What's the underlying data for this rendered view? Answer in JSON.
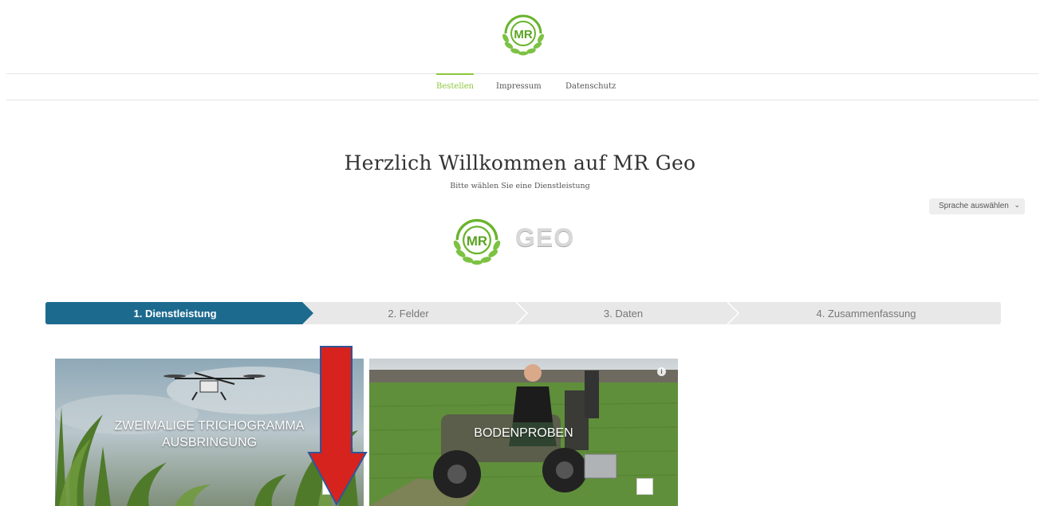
{
  "header": {
    "logo_text": "MR"
  },
  "nav": {
    "items": [
      {
        "label": "Bestellen",
        "active": true
      },
      {
        "label": "Impressum",
        "active": false
      },
      {
        "label": "Datenschutz",
        "active": false
      }
    ]
  },
  "main": {
    "title": "Herzlich Willkommen auf MR Geo",
    "subtitle": "Bitte wählen Sie eine Dienstleistung",
    "geo_logo_mr": "MR",
    "geo_logo_text": "GEO"
  },
  "language_select": {
    "label": "Sprache auswählen"
  },
  "steps": [
    {
      "label": "1. Dienstleistung",
      "active": true
    },
    {
      "label": "2. Felder",
      "active": false
    },
    {
      "label": "3. Daten",
      "active": false
    },
    {
      "label": "4. Zusammenfassung",
      "active": false
    }
  ],
  "services": [
    {
      "title_line1": "ZWEIMALIGE TRICHOGRAMMA",
      "title_line2": "AUSBRINGUNG",
      "checked": false
    },
    {
      "title_line1": "BODENPROBEN",
      "checked": false
    }
  ],
  "colors": {
    "brand_green": "#8dc63f",
    "step_active": "#1d6a8f",
    "step_inactive": "#e8e8e8",
    "annotation_arrow": "#d6231e"
  }
}
